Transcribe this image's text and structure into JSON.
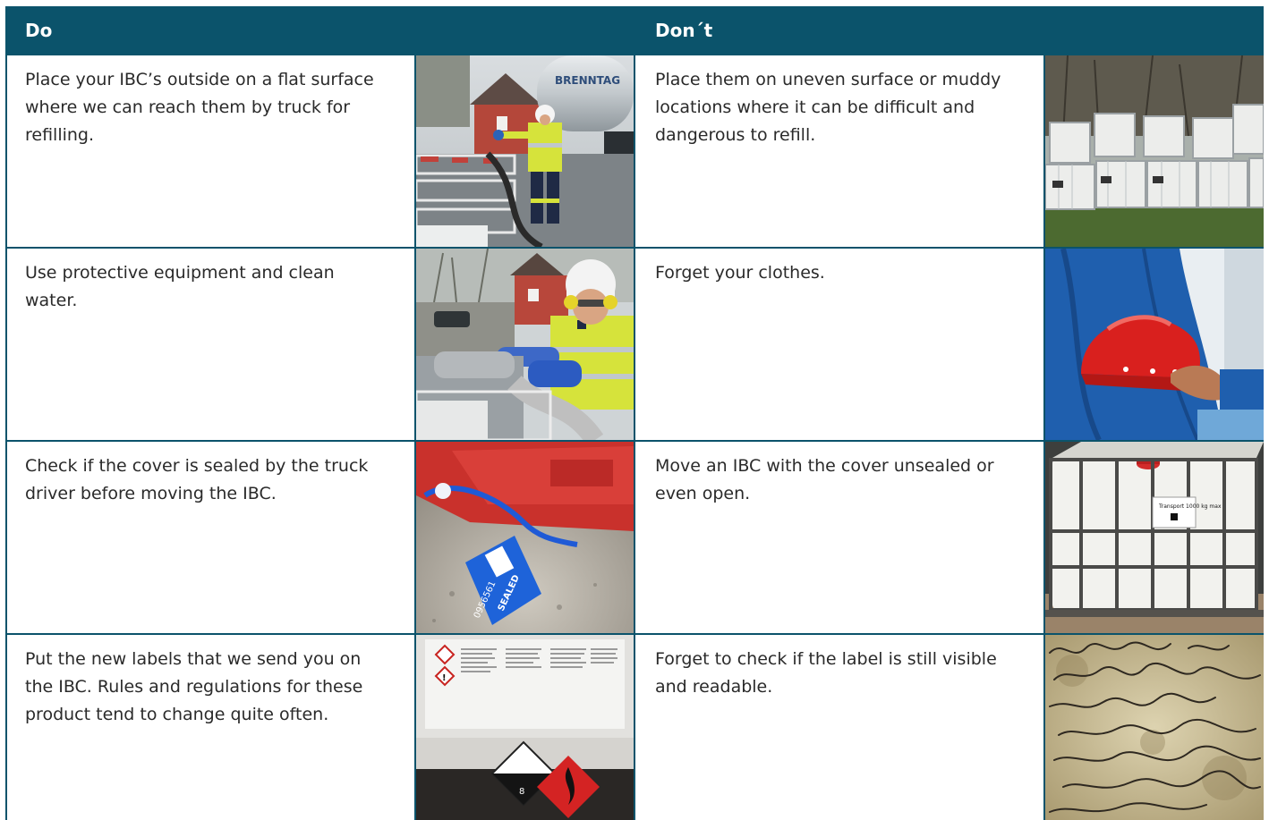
{
  "header": {
    "do_label": "Do",
    "dont_label": "Don´t"
  },
  "rows": [
    {
      "do_text": "Place your IBC’s outside on a flat surface where we can reach them by truck for refilling.",
      "do_image": "truck-driver-refilling-ibc-photo",
      "dont_text": "Place them on uneven surface or muddy locations where it can be difficult and dangerous to refill.",
      "dont_image": "stacked-ibcs-on-grass-photo"
    },
    {
      "do_text": "Use protective equipment and clean water.",
      "do_image": "worker-with-protective-gear-photo",
      "dont_text": "Forget your clothes.",
      "dont_image": "red-hard-hat-photo"
    },
    {
      "do_text": "Check if the cover is sealed by the truck driver before moving the IBC.",
      "do_image": "sealed-cover-tag-photo",
      "dont_text": "Move an IBC with the cover unsealed or even open.",
      "dont_image": "ibc-container-open-cover-photo"
    },
    {
      "do_text": "Put the new labels that we send you on the IBC. Rules and regulations for these product tend to change quite often.",
      "do_image": "hazard-label-photo",
      "dont_text": "Forget to check if the label is still visible and readable.",
      "dont_image": "illegible-handwriting-photo"
    }
  ],
  "photo_texts": {
    "truck_brand": "BRENNTAG",
    "seal_word": "SEALED",
    "seal_number": "0956561",
    "ibc_sticker": "Transport 1000 kg max",
    "hazard_class": "8"
  },
  "colors": {
    "header_bg": "#0b536b",
    "border": "#0b536b",
    "text": "#2a2a2a"
  }
}
